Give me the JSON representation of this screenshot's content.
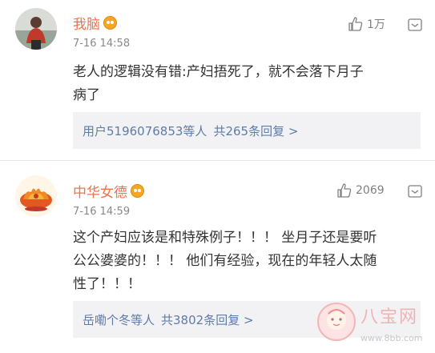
{
  "comments": [
    {
      "username": "我脑",
      "timestamp": "7-16 14:58",
      "likes": "1万",
      "content_line1": "老人的逻辑没有错:产妇捂死了，就不会落下月子",
      "content_line2": "病了",
      "reply_users": "用户5196076853等人",
      "reply_count": "共265条回复 >"
    },
    {
      "username": "中华女德",
      "timestamp": "7-16 14:59",
      "likes": "2069",
      "content_line1": "这个产妇应该是和特殊例子！！！ 坐月子还是要听",
      "content_line2": "公公婆婆的！！！ 他们有经验，现在的年轻人太随",
      "content_line3": "性了！！！",
      "reply_users": "岳嘞个冬等人",
      "reply_count": "共3802条回复 >"
    }
  ],
  "watermark": {
    "title": "八宝网",
    "url": "www.8bb.com"
  },
  "colors": {
    "username": "#eb7350",
    "reply_link": "#5d7ca8",
    "reply_bg": "#f2f2f5"
  },
  "icons": [
    "like-icon",
    "more-icon",
    "vip-badge-icon"
  ]
}
